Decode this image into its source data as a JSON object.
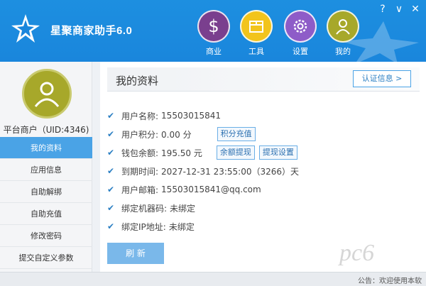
{
  "app": {
    "title": "星聚商家助手6.0",
    "window_controls": {
      "help": "?",
      "minimize": "∨",
      "close": "✕"
    }
  },
  "nav": [
    {
      "label": "商业",
      "icon": "dollar-icon",
      "color": "#7a3f8e"
    },
    {
      "label": "工具",
      "icon": "box-icon",
      "color": "#f2c41c"
    },
    {
      "label": "设置",
      "icon": "gear-icon",
      "color": "#8e5cc8"
    },
    {
      "label": "我的",
      "icon": "user-icon",
      "color": "#a7a82a"
    }
  ],
  "sidebar": {
    "user_id": "平台商户（UID:4346)",
    "items": [
      {
        "label": "我的资料",
        "active": true
      },
      {
        "label": "应用信息",
        "active": false
      },
      {
        "label": "自助解绑",
        "active": false
      },
      {
        "label": "自助充值",
        "active": false
      },
      {
        "label": "修改密码",
        "active": false
      },
      {
        "label": "提交自定义参数",
        "active": false
      }
    ]
  },
  "main": {
    "section_title": "我的资料",
    "cert_button": "认证信息 >",
    "fields": [
      {
        "key": "用户名称:",
        "value": "15503015841"
      },
      {
        "key": "用户积分:",
        "value": "0.00 分",
        "buttons": [
          "积分充值"
        ]
      },
      {
        "key": "钱包余额:",
        "value": "195.50 元",
        "buttons": [
          "余额提现",
          "提现设置"
        ]
      },
      {
        "key": "到期时间:",
        "value": "2027-12-31 23:55:00（3266）天"
      },
      {
        "key": "用户邮箱:",
        "value": "15503015841@qq.com"
      },
      {
        "key": "绑定机器码:",
        "value": "未绑定"
      },
      {
        "key": "绑定IP地址:",
        "value": "未绑定"
      }
    ],
    "refresh_button": "刷 新"
  },
  "statusbar": {
    "notice": "公告：欢迎使用本软"
  },
  "watermark": "pc6"
}
